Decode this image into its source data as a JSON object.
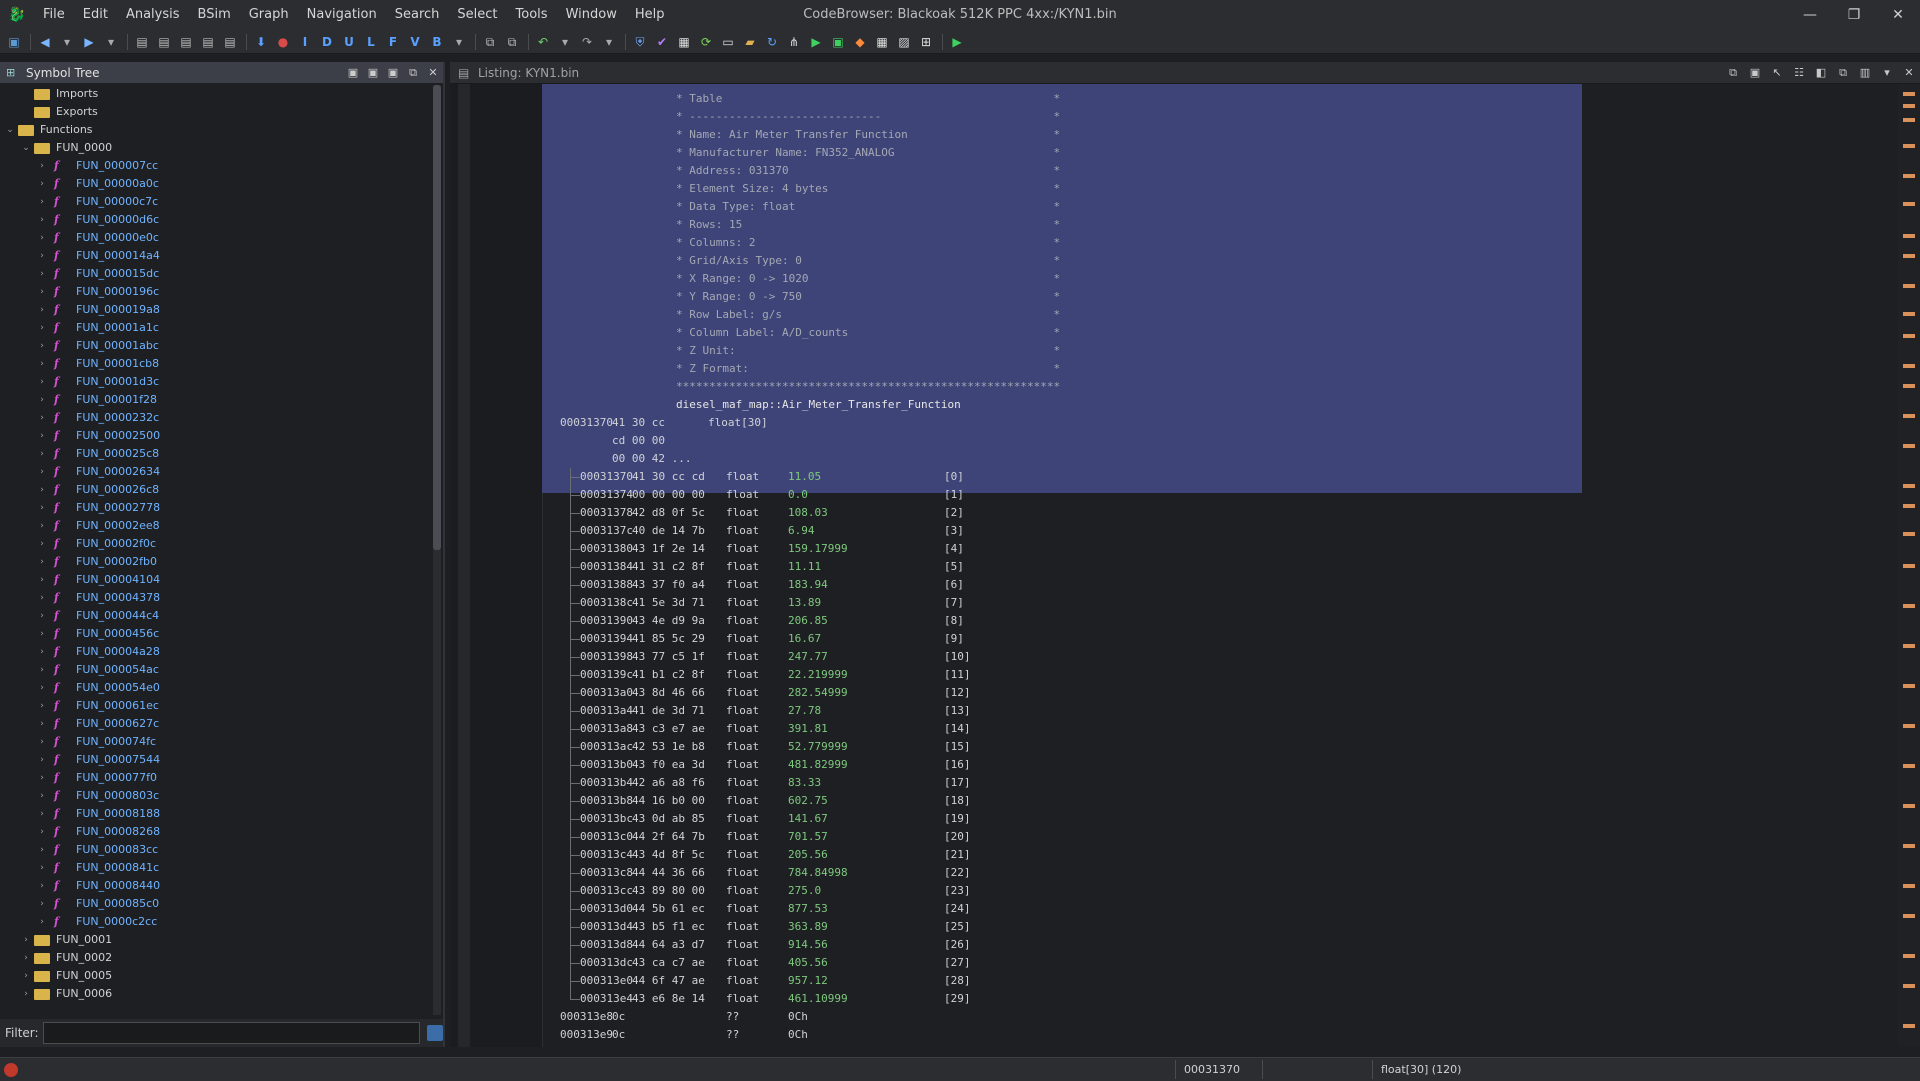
{
  "window": {
    "title": "CodeBrowser: Blackoak 512K PPC 4xx:/KYN1.bin",
    "controls": [
      "—",
      "❐",
      "✕"
    ]
  },
  "menu": [
    "File",
    "Edit",
    "Analysis",
    "BSim",
    "Graph",
    "Navigation",
    "Search",
    "Select",
    "Tools",
    "Window",
    "Help"
  ],
  "toolbar_letters": [
    "I",
    "D",
    "U",
    "L",
    "F",
    "V",
    "B"
  ],
  "symbol_tree": {
    "title": "Symbol Tree",
    "nodes": [
      {
        "label": "Imports",
        "level": 1,
        "type": "folder",
        "expanded": false
      },
      {
        "label": "Exports",
        "level": 1,
        "type": "folder",
        "expanded": false
      },
      {
        "label": "Functions",
        "level": 0,
        "type": "folder",
        "expanded": true
      },
      {
        "label": "FUN_0000",
        "level": 1,
        "type": "folder",
        "expanded": true
      },
      {
        "label": "FUN_000007cc",
        "level": 2,
        "type": "func"
      },
      {
        "label": "FUN_00000a0c",
        "level": 2,
        "type": "func"
      },
      {
        "label": "FUN_00000c7c",
        "level": 2,
        "type": "func"
      },
      {
        "label": "FUN_00000d6c",
        "level": 2,
        "type": "func"
      },
      {
        "label": "FUN_00000e0c",
        "level": 2,
        "type": "func"
      },
      {
        "label": "FUN_000014a4",
        "level": 2,
        "type": "func"
      },
      {
        "label": "FUN_000015dc",
        "level": 2,
        "type": "func"
      },
      {
        "label": "FUN_0000196c",
        "level": 2,
        "type": "func"
      },
      {
        "label": "FUN_000019a8",
        "level": 2,
        "type": "func"
      },
      {
        "label": "FUN_00001a1c",
        "level": 2,
        "type": "func"
      },
      {
        "label": "FUN_00001abc",
        "level": 2,
        "type": "func"
      },
      {
        "label": "FUN_00001cb8",
        "level": 2,
        "type": "func"
      },
      {
        "label": "FUN_00001d3c",
        "level": 2,
        "type": "func"
      },
      {
        "label": "FUN_00001f28",
        "level": 2,
        "type": "func"
      },
      {
        "label": "FUN_0000232c",
        "level": 2,
        "type": "func"
      },
      {
        "label": "FUN_00002500",
        "level": 2,
        "type": "func"
      },
      {
        "label": "FUN_000025c8",
        "level": 2,
        "type": "func"
      },
      {
        "label": "FUN_00002634",
        "level": 2,
        "type": "func"
      },
      {
        "label": "FUN_000026c8",
        "level": 2,
        "type": "func"
      },
      {
        "label": "FUN_00002778",
        "level": 2,
        "type": "func"
      },
      {
        "label": "FUN_00002ee8",
        "level": 2,
        "type": "func"
      },
      {
        "label": "FUN_00002f0c",
        "level": 2,
        "type": "func"
      },
      {
        "label": "FUN_00002fb0",
        "level": 2,
        "type": "func"
      },
      {
        "label": "FUN_00004104",
        "level": 2,
        "type": "func"
      },
      {
        "label": "FUN_00004378",
        "level": 2,
        "type": "func"
      },
      {
        "label": "FUN_000044c4",
        "level": 2,
        "type": "func"
      },
      {
        "label": "FUN_0000456c",
        "level": 2,
        "type": "func"
      },
      {
        "label": "FUN_00004a28",
        "level": 2,
        "type": "func"
      },
      {
        "label": "FUN_000054ac",
        "level": 2,
        "type": "func"
      },
      {
        "label": "FUN_000054e0",
        "level": 2,
        "type": "func"
      },
      {
        "label": "FUN_000061ec",
        "level": 2,
        "type": "func"
      },
      {
        "label": "FUN_0000627c",
        "level": 2,
        "type": "func"
      },
      {
        "label": "FUN_000074fc",
        "level": 2,
        "type": "func"
      },
      {
        "label": "FUN_00007544",
        "level": 2,
        "type": "func"
      },
      {
        "label": "FUN_000077f0",
        "level": 2,
        "type": "func"
      },
      {
        "label": "FUN_0000803c",
        "level": 2,
        "type": "func"
      },
      {
        "label": "FUN_00008188",
        "level": 2,
        "type": "func"
      },
      {
        "label": "FUN_00008268",
        "level": 2,
        "type": "func"
      },
      {
        "label": "FUN_000083cc",
        "level": 2,
        "type": "func"
      },
      {
        "label": "FUN_0000841c",
        "level": 2,
        "type": "func"
      },
      {
        "label": "FUN_00008440",
        "level": 2,
        "type": "func"
      },
      {
        "label": "FUN_000085c0",
        "level": 2,
        "type": "func"
      },
      {
        "label": "FUN_0000c2cc",
        "level": 2,
        "type": "func"
      },
      {
        "label": "FUN_0001",
        "level": 1,
        "type": "folder",
        "expanded": false
      },
      {
        "label": "FUN_0002",
        "level": 1,
        "type": "folder",
        "expanded": false
      },
      {
        "label": "FUN_0005",
        "level": 1,
        "type": "folder",
        "expanded": false
      },
      {
        "label": "FUN_0006",
        "level": 1,
        "type": "folder",
        "expanded": false
      }
    ],
    "filter_label": "Filter:",
    "filter_value": ""
  },
  "listing": {
    "title": "Listing:  KYN1.bin",
    "comment_lines": [
      "**********************************************************",
      "* Table                                                  *",
      "* -----------------------------                          *",
      "* Name: Air Meter Transfer Function                      *",
      "* Manufacturer Name: FN352_ANALOG                        *",
      "* Address: 031370                                        *",
      "* Element Size: 4 bytes                                  *",
      "* Data Type: float                                       *",
      "* Rows: 15                                               *",
      "* Columns: 2                                             *",
      "* Grid/Axis Type: 0                                      *",
      "* X Range: 0 -> 1020                                     *",
      "* Y Range: 0 -> 750                                      *",
      "* Row Label: g/s                                         *",
      "* Column Label: A/D_counts                               *",
      "* Z Unit:                                                *",
      "* Z Format:                                              *",
      "**********************************************************"
    ],
    "symbol_label": "diesel_maf_map::Air_Meter_Transfer_Function",
    "array_header": {
      "addr": "00031370",
      "bytes1": "41 30 cc",
      "type": "float[30]",
      "bytes2": "cd 00 00",
      "bytes3": "00 00 42 ..."
    },
    "rows": [
      {
        "addr": "00031370",
        "bytes": "41 30 cc cd",
        "type": "float",
        "value": "11.05",
        "index": "[0]"
      },
      {
        "addr": "00031374",
        "bytes": "00 00 00 00",
        "type": "float",
        "value": "0.0",
        "index": "[1]"
      },
      {
        "addr": "00031378",
        "bytes": "42 d8 0f 5c",
        "type": "float",
        "value": "108.03",
        "index": "[2]"
      },
      {
        "addr": "0003137c",
        "bytes": "40 de 14 7b",
        "type": "float",
        "value": "6.94",
        "index": "[3]"
      },
      {
        "addr": "00031380",
        "bytes": "43 1f 2e 14",
        "type": "float",
        "value": "159.17999",
        "index": "[4]"
      },
      {
        "addr": "00031384",
        "bytes": "41 31 c2 8f",
        "type": "float",
        "value": "11.11",
        "index": "[5]"
      },
      {
        "addr": "00031388",
        "bytes": "43 37 f0 a4",
        "type": "float",
        "value": "183.94",
        "index": "[6]"
      },
      {
        "addr": "0003138c",
        "bytes": "41 5e 3d 71",
        "type": "float",
        "value": "13.89",
        "index": "[7]"
      },
      {
        "addr": "00031390",
        "bytes": "43 4e d9 9a",
        "type": "float",
        "value": "206.85",
        "index": "[8]"
      },
      {
        "addr": "00031394",
        "bytes": "41 85 5c 29",
        "type": "float",
        "value": "16.67",
        "index": "[9]"
      },
      {
        "addr": "00031398",
        "bytes": "43 77 c5 1f",
        "type": "float",
        "value": "247.77",
        "index": "[10]"
      },
      {
        "addr": "0003139c",
        "bytes": "41 b1 c2 8f",
        "type": "float",
        "value": "22.219999",
        "index": "[11]"
      },
      {
        "addr": "000313a0",
        "bytes": "43 8d 46 66",
        "type": "float",
        "value": "282.54999",
        "index": "[12]"
      },
      {
        "addr": "000313a4",
        "bytes": "41 de 3d 71",
        "type": "float",
        "value": "27.78",
        "index": "[13]"
      },
      {
        "addr": "000313a8",
        "bytes": "43 c3 e7 ae",
        "type": "float",
        "value": "391.81",
        "index": "[14]"
      },
      {
        "addr": "000313ac",
        "bytes": "42 53 1e b8",
        "type": "float",
        "value": "52.779999",
        "index": "[15]"
      },
      {
        "addr": "000313b0",
        "bytes": "43 f0 ea 3d",
        "type": "float",
        "value": "481.82999",
        "index": "[16]"
      },
      {
        "addr": "000313b4",
        "bytes": "42 a6 a8 f6",
        "type": "float",
        "value": "83.33",
        "index": "[17]"
      },
      {
        "addr": "000313b8",
        "bytes": "44 16 b0 00",
        "type": "float",
        "value": "602.75",
        "index": "[18]"
      },
      {
        "addr": "000313bc",
        "bytes": "43 0d ab 85",
        "type": "float",
        "value": "141.67",
        "index": "[19]"
      },
      {
        "addr": "000313c0",
        "bytes": "44 2f 64 7b",
        "type": "float",
        "value": "701.57",
        "index": "[20]"
      },
      {
        "addr": "000313c4",
        "bytes": "43 4d 8f 5c",
        "type": "float",
        "value": "205.56",
        "index": "[21]"
      },
      {
        "addr": "000313c8",
        "bytes": "44 44 36 66",
        "type": "float",
        "value": "784.84998",
        "index": "[22]"
      },
      {
        "addr": "000313cc",
        "bytes": "43 89 80 00",
        "type": "float",
        "value": "275.0",
        "index": "[23]"
      },
      {
        "addr": "000313d0",
        "bytes": "44 5b 61 ec",
        "type": "float",
        "value": "877.53",
        "index": "[24]"
      },
      {
        "addr": "000313d4",
        "bytes": "43 b5 f1 ec",
        "type": "float",
        "value": "363.89",
        "index": "[25]"
      },
      {
        "addr": "000313d8",
        "bytes": "44 64 a3 d7",
        "type": "float",
        "value": "914.56",
        "index": "[26]"
      },
      {
        "addr": "000313dc",
        "bytes": "43 ca c7 ae",
        "type": "float",
        "value": "405.56",
        "index": "[27]"
      },
      {
        "addr": "000313e0",
        "bytes": "44 6f 47 ae",
        "type": "float",
        "value": "957.12",
        "index": "[28]"
      },
      {
        "addr": "000313e4",
        "bytes": "43 e6 8e 14",
        "type": "float",
        "value": "461.10999",
        "index": "[29]"
      }
    ],
    "trailing": [
      {
        "addr": "000313e8",
        "bytes": "0c",
        "type": "??",
        "value": "0Ch"
      },
      {
        "addr": "000313e9",
        "bytes": "0c",
        "type": "??",
        "value": "0Ch"
      }
    ]
  },
  "status": {
    "address": "00031370",
    "datatype": "float[30]  (120)"
  },
  "colors": {
    "accent": "#3e4478",
    "value_green": "#7fc97f",
    "label_blue": "#6fb3ff",
    "func_magenta": "#d94fd4"
  }
}
